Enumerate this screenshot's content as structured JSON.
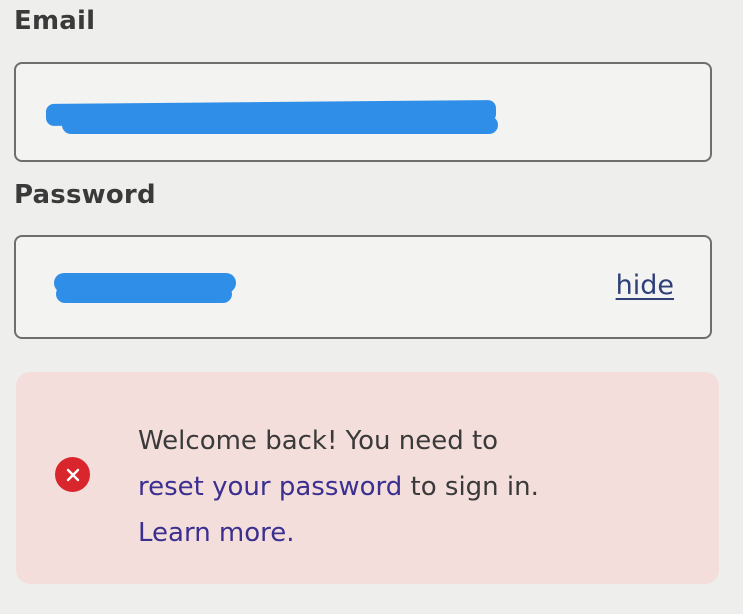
{
  "email": {
    "label": "Email"
  },
  "password": {
    "label": "Password",
    "toggle_label": "hide"
  },
  "alert": {
    "icon": "error-icon",
    "line1": "Welcome back! You need to",
    "link_reset": "reset your password",
    "line2_rest": " to sign in.",
    "link_learn": "Learn more.",
    "colors": {
      "background": "#f3dedb",
      "icon": "#d9262d",
      "link": "#3b2f8f"
    }
  }
}
